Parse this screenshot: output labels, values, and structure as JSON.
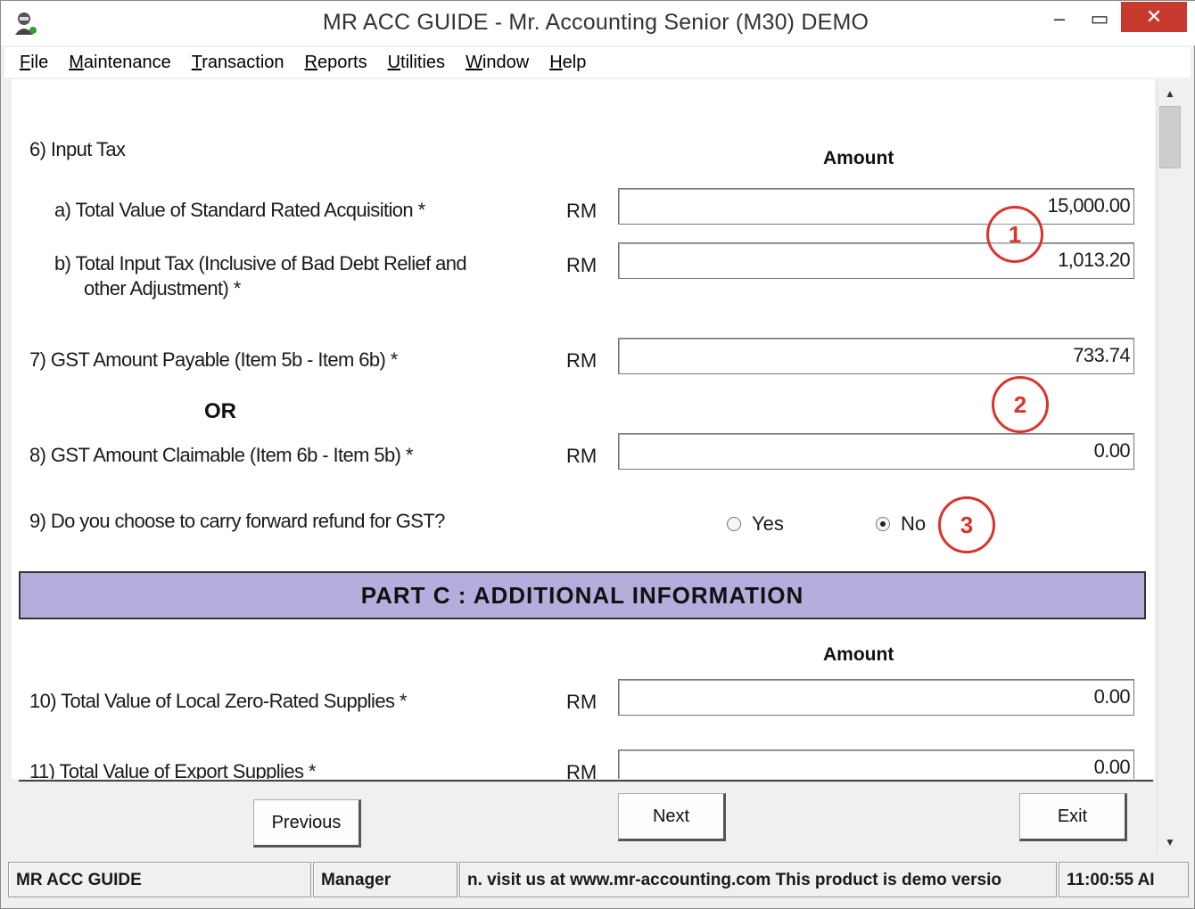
{
  "window": {
    "title": "MR ACC GUIDE - Mr. Accounting Senior (M30) DEMO",
    "minimize_glyph": "–",
    "maximize_glyph": "▭",
    "close_glyph": "✕"
  },
  "menu": [
    {
      "key": "F",
      "rest": "ile"
    },
    {
      "key": "M",
      "rest": "aintenance"
    },
    {
      "key": "T",
      "rest": "ransaction"
    },
    {
      "key": "R",
      "rest": "eports"
    },
    {
      "key": "U",
      "rest": "tilities"
    },
    {
      "key": "W",
      "rest": "indow"
    },
    {
      "key": "H",
      "rest": "elp"
    }
  ],
  "form": {
    "item6_label": "6)  Input Tax",
    "amount_header": "Amount",
    "currency": "RM",
    "item6a_label": "a)  Total Value of Standard Rated Acquisition *",
    "item6a_value": "15,000.00",
    "item6b_label_line1": "b)  Total Input Tax (Inclusive of Bad Debt Relief and",
    "item6b_label_line2": "other Adjustment) *",
    "item6b_value": "1,013.20",
    "item7_label": "7)  GST Amount Payable (Item 5b - Item 6b) *",
    "item7_value": "733.74",
    "or_label": "OR",
    "item8_label": "8)  GST Amount Claimable (Item 6b - Item 5b) *",
    "item8_value": "0.00",
    "item9_label": "9)  Do you choose to carry forward refund for GST?",
    "radio_yes": "Yes",
    "radio_no": "No",
    "radio_selected": "No",
    "part_c_title": "PART C : ADDITIONAL INFORMATION",
    "item10_label": "10)  Total Value of Local Zero-Rated Supplies *",
    "item10_value": "0.00",
    "item11_label": "11)  Total Value of Export Supplies *",
    "item11_value": "0.00"
  },
  "annotations": [
    "1",
    "2",
    "3"
  ],
  "buttons": {
    "previous": "Previous",
    "next": "Next",
    "exit": "Exit"
  },
  "status": {
    "app": "MR ACC GUIDE",
    "user": "Manager",
    "marquee": "n.  visit us at www.mr-accounting.com This product is demo versio",
    "time": "11:00:55 AI"
  },
  "colors": {
    "part_c_bg": "#b3aedc",
    "close_btn": "#c73b2e",
    "annotation": "#d9342b"
  }
}
